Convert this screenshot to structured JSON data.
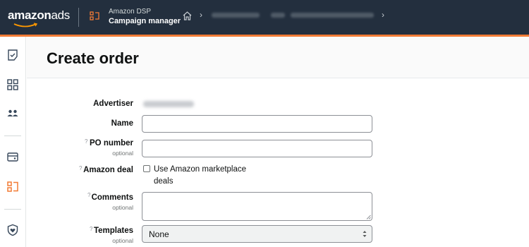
{
  "topbar": {
    "logo_bold": "amazon",
    "logo_light": "ads",
    "product": "Amazon DSP",
    "section": "Campaign manager",
    "accent_color": "#f27b35",
    "background_color": "#232f3e"
  },
  "page": {
    "title": "Create order"
  },
  "form": {
    "advertiser_label": "Advertiser",
    "name_label": "Name",
    "po_label": "PO number",
    "po_sublabel": "optional",
    "deal_label": "Amazon deal",
    "deal_checkbox_label": "Use Amazon marketplace deals",
    "comments_label": "Comments",
    "comments_sublabel": "optional",
    "templates_label": "Templates",
    "templates_sublabel": "optional",
    "templates_value": "None",
    "help_marker": "?"
  },
  "icons": {
    "sidebar": [
      "tasks-icon",
      "dashboard-icon",
      "audiences-icon",
      "billing-icon",
      "dsp-icon",
      "shield-icon"
    ]
  }
}
